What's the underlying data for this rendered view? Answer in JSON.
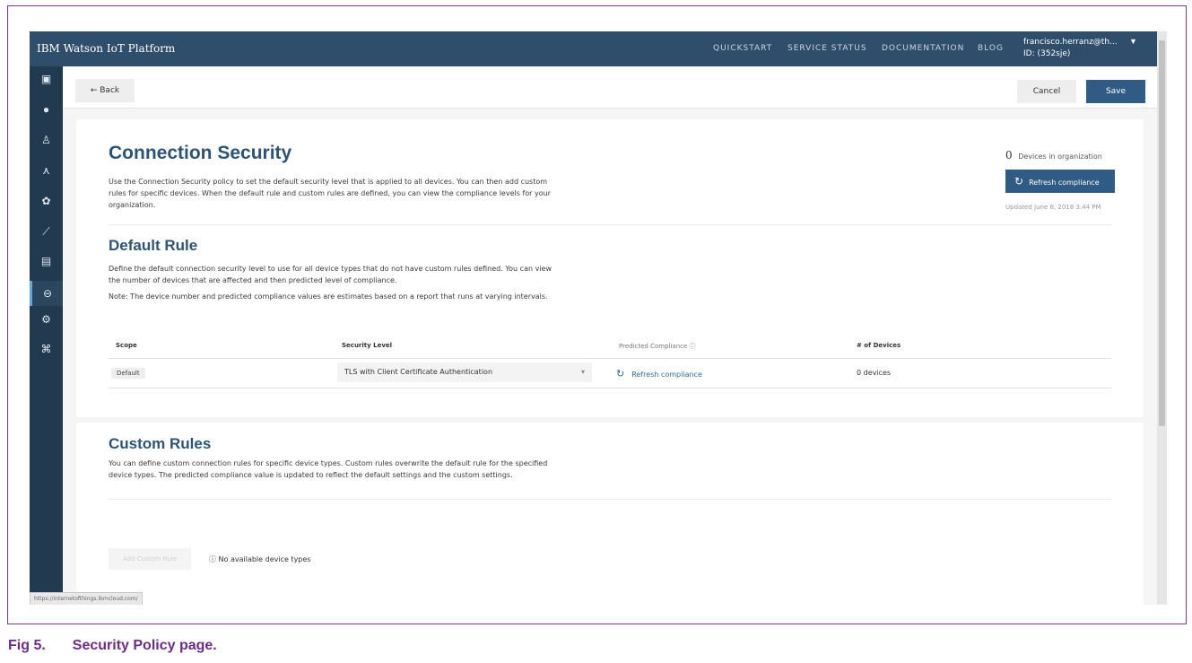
{
  "header": {
    "brand": "IBM Watson IoT Platform",
    "nav": [
      "QUICKSTART",
      "SERVICE STATUS",
      "DOCUMENTATION",
      "BLOG"
    ],
    "user_email": "francisco.herranz@th...",
    "user_id": "ID: (352sje)"
  },
  "sidebar": {
    "icons": [
      "boards-icon",
      "settings-gear-icon",
      "members-icon",
      "apps-icon",
      "rules-icon",
      "usage-icon",
      "logs-icon",
      "security-lock-icon",
      "extensions-icon",
      "network-icon"
    ],
    "active_index": 7
  },
  "toolbar": {
    "back_label": "← Back",
    "cancel_label": "Cancel",
    "save_label": "Save"
  },
  "connection_security": {
    "title": "Connection Security",
    "description": "Use the Connection Security policy to set the default security level that is applied to all devices. You can then add custom rules for specific devices. When the default rule and custom rules are defined, you can view the compliance levels for your organization.",
    "device_count": "0",
    "device_count_label": "Devices in organization",
    "refresh_button": "Refresh compliance",
    "updated": "Updated June 6, 2018 3:44 PM"
  },
  "default_rule": {
    "title": "Default Rule",
    "description": "Define the default connection security level to use for all device types that do not have custom rules defined. You can view the number of devices that are affected and then predicted level of compliance.",
    "note": "Note: The device number and predicted compliance values are estimates based on a report that runs at varying intervals.",
    "columns": {
      "scope": "Scope",
      "security_level": "Security Level",
      "predicted_compliance": "Predicted Compliance ⓘ",
      "devices": "# of Devices"
    },
    "row": {
      "scope": "Default",
      "security_level": "TLS with Client Certificate Authentication",
      "compliance_link": "Refresh compliance",
      "devices": "0 devices"
    }
  },
  "custom_rules": {
    "title": "Custom Rules",
    "description": "You can define custom connection rules for specific device types. Custom rules overwrite the default rule for the specified device types. The predicted compliance value is updated to reflect the default settings and the custom settings.",
    "add_button": "Add Custom Rule",
    "no_types": "ⓘ No available device types"
  },
  "statusbar": {
    "url": "https://internetofthings.ibmcloud.com/"
  },
  "caption": {
    "number": "Fig 5.",
    "text": "Security Policy page."
  }
}
